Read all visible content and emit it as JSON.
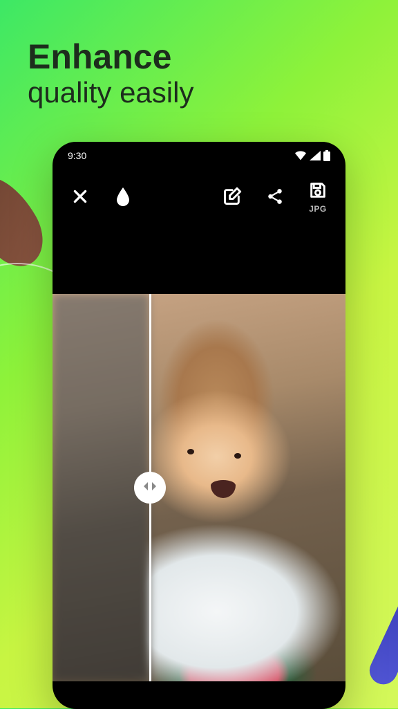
{
  "promo": {
    "headline_bold": "Enhance",
    "headline_light": "quality easily"
  },
  "status_bar": {
    "time": "9:30"
  },
  "toolbar": {
    "close_label": "Close",
    "drop_label": "Adjust",
    "edit_label": "Edit",
    "share_label": "Share",
    "save_label": "Save",
    "save_format": "JPG"
  },
  "slider": {
    "handle_label": "Compare slider"
  }
}
